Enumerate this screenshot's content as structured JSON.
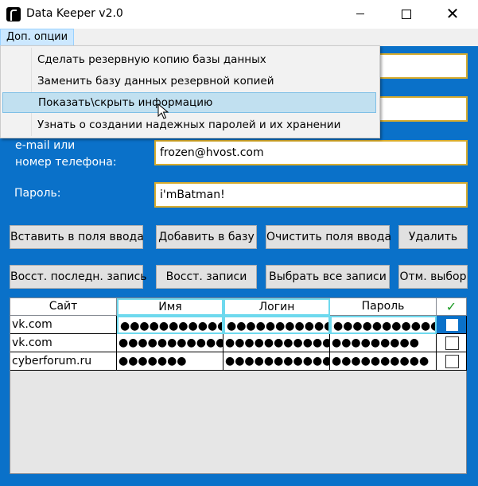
{
  "window": {
    "title": "Data Keeper v2.0",
    "close_glyph": "✕"
  },
  "menu": {
    "extra_options": "Доп. опции",
    "items": [
      "Сделать резервную копию базы данных",
      "Заменить базу данных резервной копией",
      "Показать\\скрыть информацию",
      "Узнать о создании надежных паролей и их хранении"
    ],
    "highlighted_index": 2
  },
  "form": {
    "email_label_line1": "e-mail или",
    "email_label_line2": "номер телефона:",
    "email_value": "frozen@hvost.com",
    "password_label": "Пароль:",
    "password_value": "i'mBatman!"
  },
  "buttons": {
    "insert": "Вставить в поля ввода",
    "add": "Добавить в базу",
    "clear": "Очистить поля ввода",
    "delete": "Удалить",
    "restore_last": "Восст. последн. запись",
    "restore": "Восст. записи",
    "select_all": "Выбрать все записи",
    "deselect": "Отм. выбор"
  },
  "table": {
    "headers": [
      "Сайт",
      "Имя",
      "Логин",
      "Пароль",
      "✓"
    ],
    "rows": [
      {
        "site": "vk.com",
        "name": "●●●●●●●●●●●",
        "login": "●●●●●●●●●●●●●●",
        "password": "●●●●●●●●●●●●●●",
        "checked": false
      },
      {
        "site": "vk.com",
        "name": "●●●●●●●●●●●●●●",
        "login": "●●●●●●●●●●●●●●",
        "password": "●●●●●●●●●",
        "checked": false
      },
      {
        "site": "cyberforum.ru",
        "name": "●●●●●●●",
        "login": "●●●●●●●●●●●●●●",
        "password": "●●●●●●●●●●",
        "checked": false
      }
    ]
  },
  "colors": {
    "background": "#0a71c9",
    "input_border": "#d7ac2e",
    "highlight_border": "#6ed9ee",
    "check_green": "#1a9a23"
  }
}
